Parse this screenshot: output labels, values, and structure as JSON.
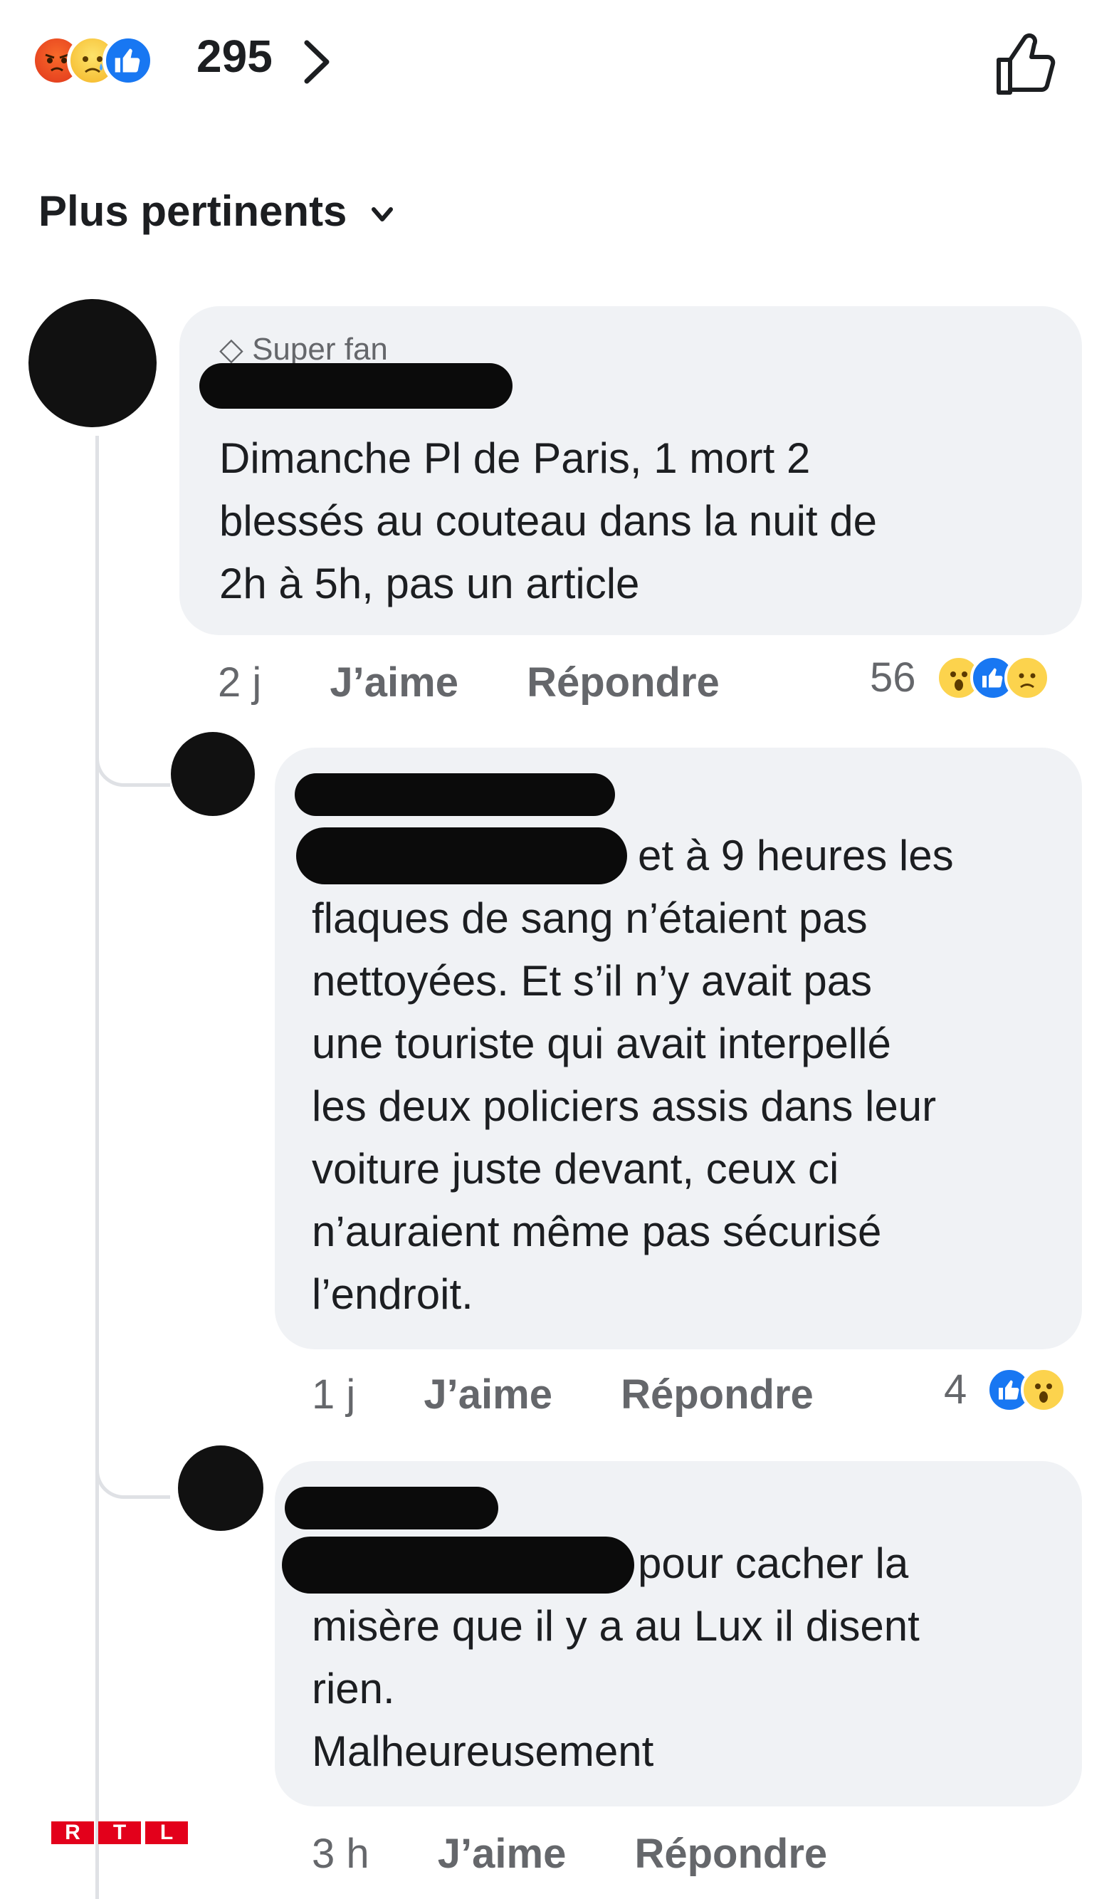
{
  "header": {
    "reaction_icons": [
      "angry-reaction-icon",
      "sad-reaction-icon",
      "like-reaction-icon"
    ],
    "reaction_count": "295",
    "chevron_icon": "chevron-right-icon",
    "like_icon": "thumbs-up-outline-icon"
  },
  "sort": {
    "label": "Plus pertinents"
  },
  "comments": [
    {
      "badge": "Super fan",
      "text_lines": [
        "Dimanche Pl de Paris, 1 mort 2",
        "blessés au couteau dans la nuit de",
        "2h à 5h, pas un article"
      ],
      "time": "2 j",
      "like_label": "J’aime",
      "reply_label": "Répondre",
      "reactions_count": "56",
      "reaction_icons": [
        "wow-reaction-icon",
        "like-reaction-icon",
        "sad-reaction-icon"
      ]
    },
    {
      "text_lines": [
        "et à 9 heures les",
        "flaques de sang n’étaient pas",
        "nettoyées. Et s’il n’y avait pas",
        "une touriste qui avait interpellé",
        "les deux policiers assis dans leur",
        "voiture juste devant, ceux ci",
        "n’auraient même pas sécurisé",
        "l’endroit."
      ],
      "time": "1 j",
      "like_label": "J’aime",
      "reply_label": "Répondre",
      "reactions_count": "4",
      "reaction_icons": [
        "like-reaction-icon",
        "wow-reaction-icon"
      ]
    },
    {
      "text_lines": [
        "pour cacher la",
        "misère que il y a au Lux il disent",
        "rien.",
        "Malheureusement"
      ],
      "time": "3 h",
      "like_label": "J’aime",
      "reply_label": "Répondre"
    }
  ],
  "watermark": {
    "letters": [
      "R",
      "T",
      "L"
    ]
  },
  "colors": {
    "like_blue": "#1877f2",
    "bubble_gray": "#f0f2f5",
    "meta_gray": "#65676b",
    "rtl_red": "#e3001b"
  }
}
